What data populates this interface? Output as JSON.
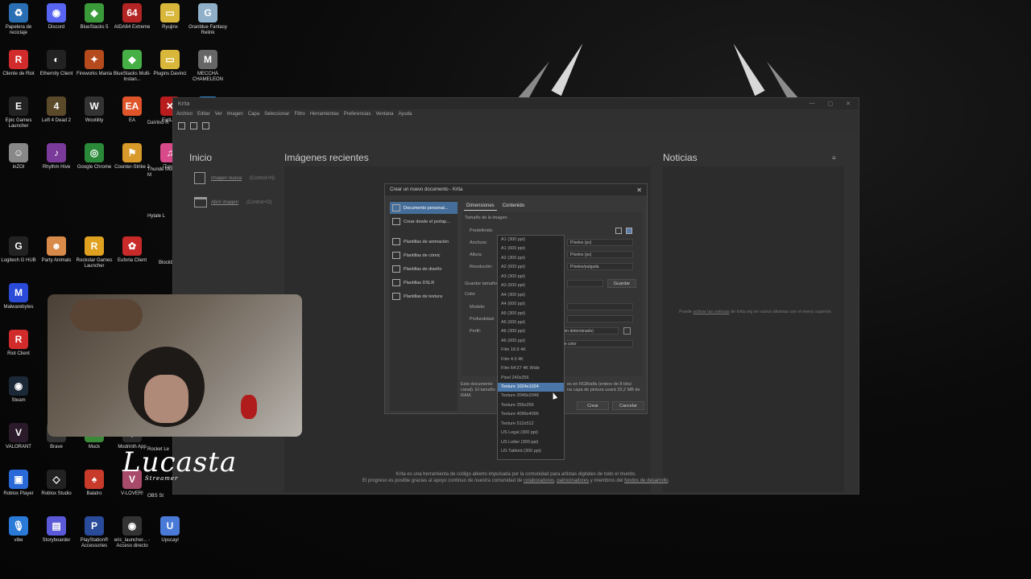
{
  "desktop_icons": [
    {
      "label": "Papelera de reciclaje",
      "color": "#2a6fb3",
      "glyph": "♻"
    },
    {
      "label": "Discord",
      "color": "#5865f2",
      "glyph": "◉"
    },
    {
      "label": "BlueStacks 5",
      "color": "#3a9a3a",
      "glyph": "◆"
    },
    {
      "label": "AIDA64 Extreme",
      "color": "#b32424",
      "glyph": "64"
    },
    {
      "label": "Ryujinx",
      "color": "#d8b73a",
      "glyph": "▭"
    },
    {
      "label": "Granblue Fantasy Relink",
      "color": "#8fb0c8",
      "glyph": "G"
    },
    {
      "label": "Cliente de Riot",
      "color": "#d12b2b",
      "glyph": "R"
    },
    {
      "label": "Ethernity Client",
      "color": "#222",
      "glyph": "◐"
    },
    {
      "label": "Fireworks Mania",
      "color": "#b54a1c",
      "glyph": "✦"
    },
    {
      "label": "BlueStacks Multi-Instan...",
      "color": "#46b046",
      "glyph": "◆"
    },
    {
      "label": "Plugins Davinci",
      "color": "#d8b73a",
      "glyph": "▭"
    },
    {
      "label": "MECCHA CHAMELEON",
      "color": "#666",
      "glyph": "M"
    },
    {
      "label": "Epic Games Launcher",
      "color": "#222",
      "glyph": "E"
    },
    {
      "label": "Left 4 Dead 2",
      "color": "#5a4a2a",
      "glyph": "4"
    },
    {
      "label": "Wootility",
      "color": "#333",
      "glyph": "W"
    },
    {
      "label": "EA",
      "color": "#e0542a",
      "glyph": "EA"
    },
    {
      "label": "ExitLag",
      "color": "#b81c1c",
      "glyph": "✕"
    },
    {
      "label": "Fortnite",
      "color": "#2a8ad8",
      "glyph": "F"
    },
    {
      "label": "inZOI",
      "color": "#888",
      "glyph": "☺"
    },
    {
      "label": "Rhythm Hive",
      "color": "#7a3a9a",
      "glyph": "♪"
    },
    {
      "label": "Google Chrome",
      "color": "#2a8a3a",
      "glyph": "◎"
    },
    {
      "label": "Counter-Strike 2",
      "color": "#d89a2a",
      "glyph": "⚑"
    },
    {
      "label": "iTunes",
      "color": "#d84a8a",
      "glyph": "♫"
    },
    {
      "label": "BLOODSTRIKE",
      "color": "#222",
      "glyph": "B"
    },
    {
      "label": "Logitech G HUB",
      "color": "#222",
      "glyph": "G"
    },
    {
      "label": "Party Animals",
      "color": "#d88a4a",
      "glyph": "☻"
    },
    {
      "label": "Rockstar Games Launcher",
      "color": "#e0a020",
      "glyph": "R"
    },
    {
      "label": "Euforia Client",
      "color": "#c82a2a",
      "glyph": "✿"
    },
    {
      "label": "Malwarebytes",
      "color": "#2a4ad8",
      "glyph": "M"
    },
    {
      "label": "Riot Client",
      "color": "#d12b2b",
      "glyph": "R"
    },
    {
      "label": "Steam",
      "color": "#1b2838",
      "glyph": "◉"
    },
    {
      "label": "VALORANT",
      "color": "#2a1a2a",
      "glyph": "V"
    },
    {
      "label": "Brave",
      "color": "#333",
      "glyph": "B"
    },
    {
      "label": "Muck",
      "color": "#3a8a3a",
      "glyph": "M"
    },
    {
      "label": "Modrinth App",
      "color": "#2a2a2a",
      "glyph": "◈"
    },
    {
      "label": "Roblox Player",
      "color": "#2a6ad8",
      "glyph": "▣"
    },
    {
      "label": "Roblox Studio",
      "color": "#222",
      "glyph": "◇"
    },
    {
      "label": "Balatro",
      "color": "#c83a2a",
      "glyph": "♠"
    },
    {
      "label": "V-LOVER!",
      "color": "#a84a6a",
      "glyph": "V"
    },
    {
      "label": "vibe",
      "color": "#2a7ad8",
      "glyph": "🎙"
    },
    {
      "label": "Storyboarder",
      "color": "#5a5ad8",
      "glyph": "▤"
    },
    {
      "label": "PlayStation® Accessories",
      "color": "#2a4a9a",
      "glyph": "P"
    },
    {
      "label": "eric_launcher... - Acceso directo",
      "color": "#333",
      "glyph": "◉"
    },
    {
      "label": "Upscayl",
      "color": "#4a7ad8",
      "glyph": "U"
    }
  ],
  "partial_icons": [
    "Thunde Mod M",
    "Hytale L",
    "DaVinci R",
    "Blockb",
    "Rocket Le",
    "OBS St"
  ],
  "krita": {
    "title": "Krita",
    "menu": [
      "Archivo",
      "Editar",
      "Ver",
      "Imagen",
      "Capa",
      "Seleccionar",
      "Filtro",
      "Herramientas",
      "Preferencias",
      "Ventana",
      "Ayuda"
    ],
    "start_heading": "Inicio",
    "new_image": "Imagen nueva",
    "new_shortcut": "(Control+N)",
    "open_image": "Abrir imagen",
    "open_shortcut": "(Control+O)",
    "recent_heading": "Imágenes recientes",
    "news_heading": "Noticias",
    "news_text_pre": "Puede ",
    "news_link": "activar las noticias",
    "news_text_post": " de krita.org en varios idiomas con el menú superior.",
    "footer1": "Krita es una herramienta de código abierto impulsada por la comunidad para artistas digitales de todo el mundo.",
    "footer2_a": "El progreso es posible gracias al apoyo continuo de nuestra comunidad de ",
    "footer2_b": "colaboradores",
    "footer2_c": ", ",
    "footer2_d": "patrocinadores",
    "footer2_e": " y miembros del ",
    "footer2_f": "fondos de desarrollo",
    "footer2_g": "."
  },
  "dialog": {
    "title": "Crear un nuevo documento - Krita",
    "sidebar": [
      "Documento personal...",
      "Crear desde el portap...",
      "Plantillas de animación",
      "Plantillas de cómic",
      "Plantillas de diseño",
      "Plantillas DSLR",
      "Plantillas de textura"
    ],
    "tab_dimensions": "Dimensiones",
    "tab_content": "Contenido",
    "size_heading": "Tamaño de la imagen",
    "predefined": "Predefinido:",
    "width": "Anchura:",
    "height": "Altura:",
    "resolution": "Resolución:",
    "width_unit": "Píxeles (px)",
    "height_unit": "Píxeles (px)",
    "resolution_unit": "Píxeles/pulgada",
    "save_size": "Guardar tamaño",
    "save_button": "Guardar",
    "color_heading": "Color",
    "model": "Modelo:",
    "depth": "Profundidad:",
    "profile": "Perfil:",
    "profile_value": "(sin determinado)",
    "color_space": "de color",
    "desc_left": "Este documento\ncanal). El tamaño\nRAM.",
    "desc_right": "es en RGB/alfa (entero de 8 bits/\nna capa de pintura usará 33,2 MB de",
    "create": "Crear",
    "cancel": "Cancelar"
  },
  "preset_list": {
    "items": [
      "A1 (300 ppi)",
      "A1 (600 ppi)",
      "A2 (300 ppi)",
      "A2 (600 ppi)",
      "A3 (300 ppi)",
      "A3 (600 ppi)",
      "A4 (300 ppi)",
      "A4 (600 ppi)",
      "A5 (300 ppi)",
      "A5 (600 ppi)",
      "A6 (300 ppi)",
      "A6 (600 ppi)",
      "Film 16:9 4K",
      "Film 4:3 4K",
      "Film 64:27 4K Wide",
      "Pixel 240x256",
      "Texture 1024x1024",
      "Texture 2048x2048",
      "Texture 256x256",
      "Texture 4096x4096",
      "Texture 512x512",
      "US Legal (300 ppi)",
      "US Letter (300 ppi)",
      "US Tabloid (300 ppi)"
    ],
    "highlighted": "Texture 1024x1024"
  },
  "overlay": {
    "logo": "Lucasta",
    "logo_sub": "Streamer"
  }
}
